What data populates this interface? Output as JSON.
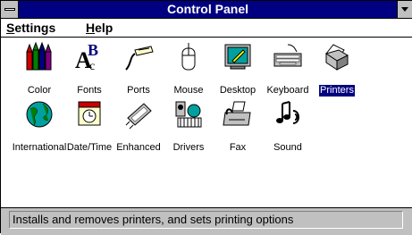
{
  "window": {
    "title": "Control Panel"
  },
  "menu": {
    "settings": {
      "mnemonic": "S",
      "rest": "ettings"
    },
    "help": {
      "mnemonic": "H",
      "rest": "elp"
    }
  },
  "icons": [
    {
      "label": "Color",
      "icon": "color-icon"
    },
    {
      "label": "Fonts",
      "icon": "fonts-icon"
    },
    {
      "label": "Ports",
      "icon": "ports-icon"
    },
    {
      "label": "Mouse",
      "icon": "mouse-icon"
    },
    {
      "label": "Desktop",
      "icon": "desktop-icon"
    },
    {
      "label": "Keyboard",
      "icon": "keyboard-icon"
    },
    {
      "label": "Printers",
      "icon": "printers-icon",
      "selected": true
    },
    {
      "label": "International",
      "icon": "international-icon"
    },
    {
      "label": "Date/Time",
      "icon": "date-time-icon"
    },
    {
      "label": "Enhanced",
      "icon": "enhanced-icon"
    },
    {
      "label": "Drivers",
      "icon": "drivers-icon"
    },
    {
      "label": "Fax",
      "icon": "fax-icon"
    },
    {
      "label": "Sound",
      "icon": "sound-icon"
    }
  ],
  "status": {
    "text": "Installs and removes printers, and sets printing options"
  },
  "colors": {
    "title_bar": "#000080",
    "selection": "#000080",
    "chrome": "#c0c0c0"
  }
}
